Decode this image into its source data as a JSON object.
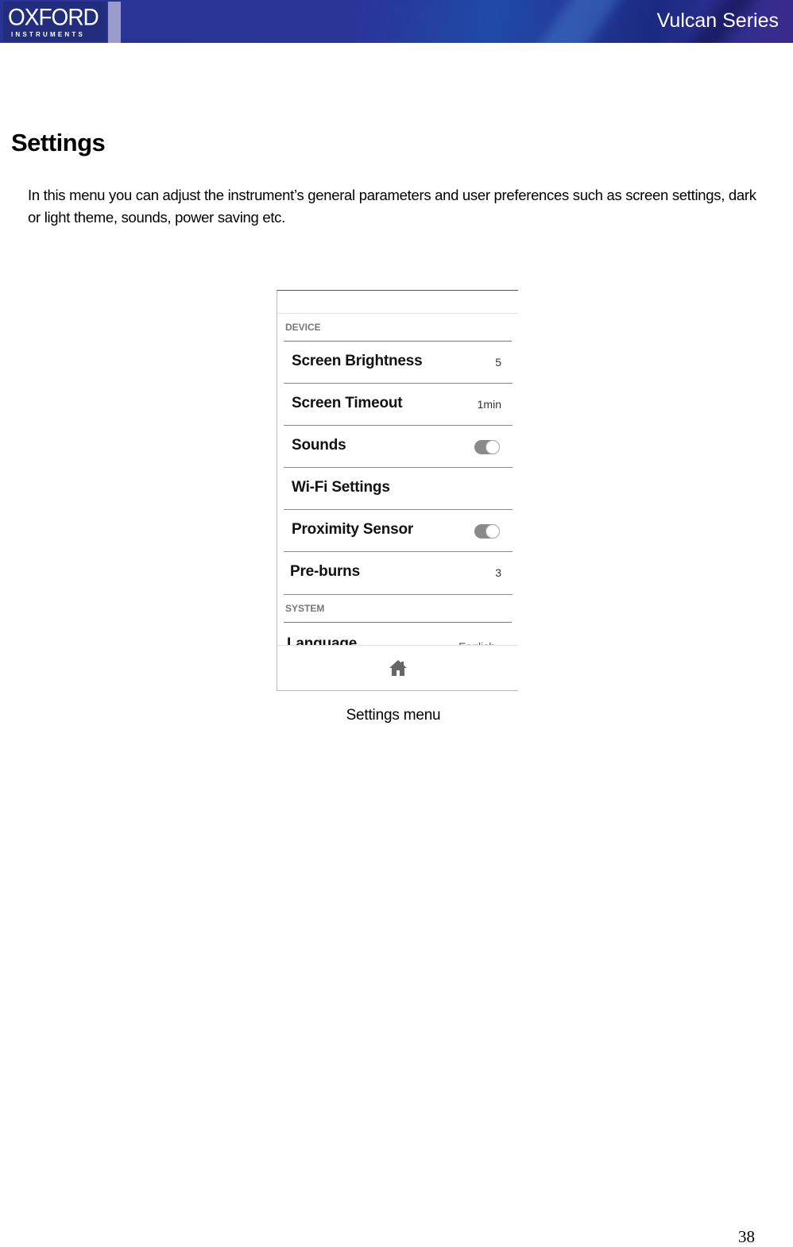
{
  "header": {
    "logo_main": "OXFORD",
    "logo_sub": "INSTRUMENTS",
    "series_title": "Vulcan Series",
    "colors": {
      "banner": "#2a3496",
      "logo_bg": "#232d7e"
    }
  },
  "section": {
    "title": "Settings",
    "intro": "In this menu you can adjust the instrument’s general parameters and user preferences such as screen settings, dark or light theme, sounds, power saving etc."
  },
  "screenshot": {
    "device_header": "DEVICE",
    "items": [
      {
        "label": "Screen Brightness",
        "value": "5"
      },
      {
        "label": "Screen Timeout",
        "value": "1min"
      },
      {
        "label": "Sounds",
        "toggle": "on"
      },
      {
        "label": "Wi-Fi Settings"
      },
      {
        "label": "Proximity Sensor",
        "toggle": "on"
      },
      {
        "label": "Pre-burns",
        "value": "3"
      }
    ],
    "system_header": "SYSTEM",
    "language": {
      "label": "Language",
      "value": "English"
    },
    "bottom_icon": "home-icon"
  },
  "caption": "Settings menu",
  "page_number": "38"
}
